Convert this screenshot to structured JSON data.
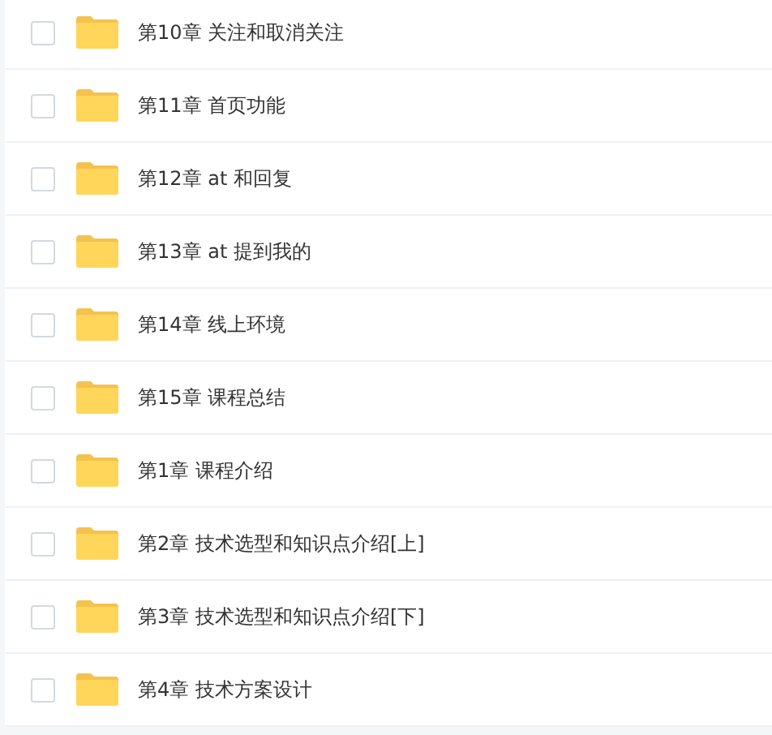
{
  "items": [
    {
      "title": "第10章 关注和取消关注",
      "checked": false
    },
    {
      "title": "第11章 首页功能",
      "checked": false
    },
    {
      "title": "第12章 at 和回复",
      "checked": false
    },
    {
      "title": "第13章 at 提到我的",
      "checked": false
    },
    {
      "title": "第14章 线上环境",
      "checked": false
    },
    {
      "title": "第15章 课程总结",
      "checked": false
    },
    {
      "title": "第1章 课程介绍",
      "checked": false
    },
    {
      "title": "第2章 技术选型和知识点介绍[上]",
      "checked": false
    },
    {
      "title": "第3章 技术选型和知识点介绍[下]",
      "checked": false
    },
    {
      "title": "第4章 技术方案设计",
      "checked": false
    }
  ]
}
